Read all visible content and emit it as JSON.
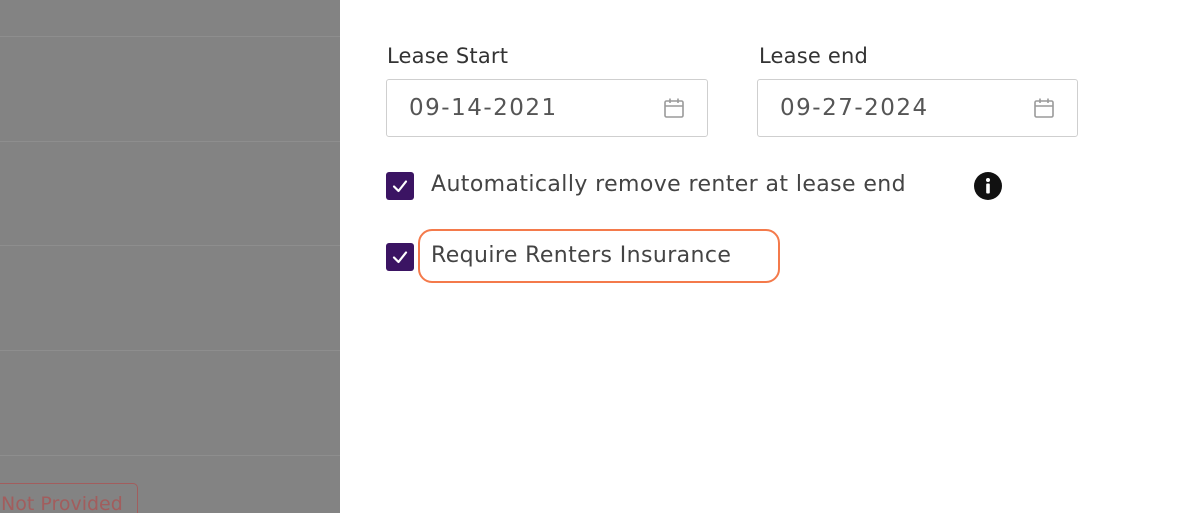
{
  "background": {
    "status_badge": "Not Provided",
    "status_color": "#a25d5d"
  },
  "lease": {
    "start_label": "Lease Start",
    "start_value": "09-14-2021",
    "end_label": "Lease end",
    "end_value": "09-27-2024"
  },
  "options": {
    "auto_remove_label": "Automatically remove renter at lease end",
    "auto_remove_checked": true,
    "require_insurance_label": "Require Renters Insurance",
    "require_insurance_checked": true
  },
  "colors": {
    "checkbox": "#3b1463",
    "highlight": "#f47a4b"
  },
  "icons": {
    "date_picker": "calendar-icon",
    "info": "info-icon",
    "check": "check-icon"
  }
}
